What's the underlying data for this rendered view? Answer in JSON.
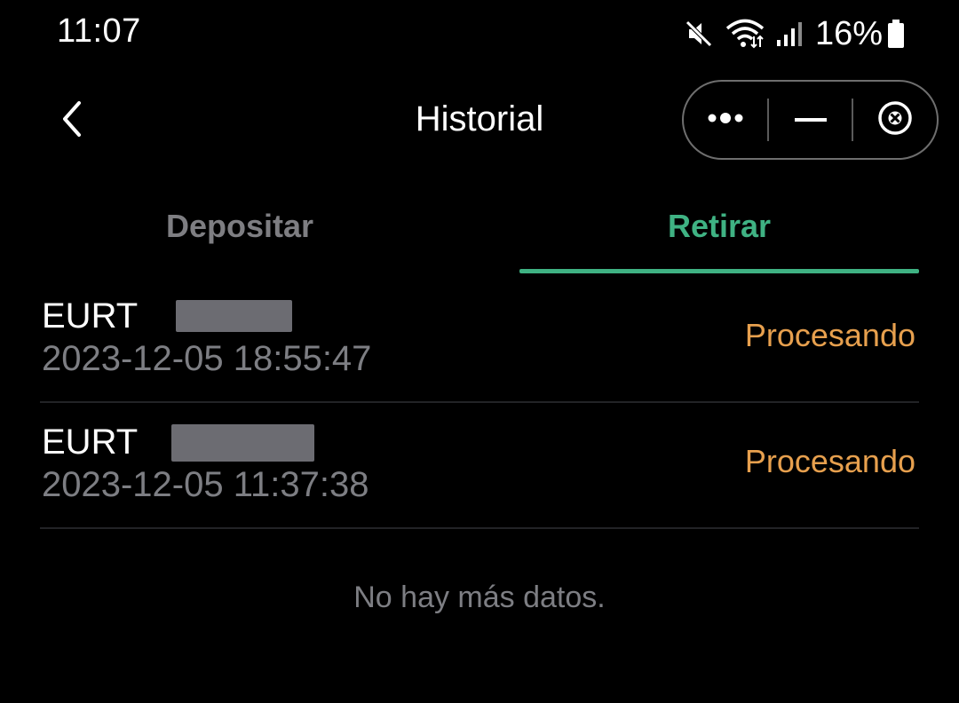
{
  "status_bar": {
    "time": "11:07",
    "battery": "16%",
    "icons": [
      "mute-icon",
      "wifi-icon",
      "signal-icon",
      "battery-icon"
    ]
  },
  "header": {
    "title": "Historial",
    "back_icon": "chevron-left-icon",
    "capsule_icons": [
      "more-icon",
      "minimize-icon",
      "close-icon"
    ]
  },
  "tabs": [
    {
      "label": "Depositar",
      "active": false
    },
    {
      "label": "Retirar",
      "active": true
    }
  ],
  "records": [
    {
      "coin": "EURT",
      "date": "2023-12-05 18:55:47",
      "status": "Procesando"
    },
    {
      "coin": "EURT",
      "date": "2023-12-05 11:37:38",
      "status": "Procesando"
    }
  ],
  "footer_text": "No hay más datos.",
  "colors": {
    "background": "#000000",
    "accent": "#3fb283",
    "status_pending": "#e7a04e",
    "muted_text": "#7d7e83"
  }
}
